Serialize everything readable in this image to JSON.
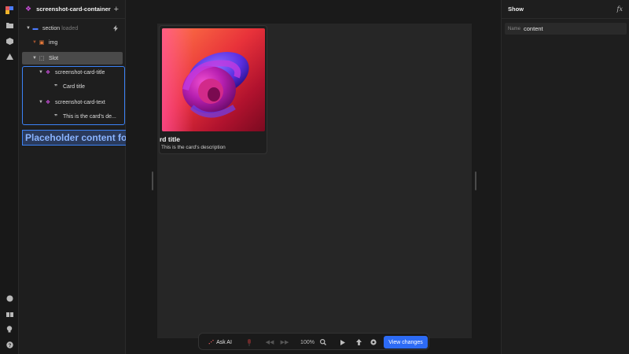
{
  "rail": {
    "icons_top": [
      "logo-icon",
      "folder-icon",
      "cube-icon",
      "warning-icon"
    ],
    "icons_bottom": [
      "palette-icon",
      "gift-icon",
      "lightbulb-icon",
      "help-icon"
    ]
  },
  "layers": {
    "title": "screenshot-card-container",
    "add_label": "+",
    "tree": {
      "section": {
        "label": "section",
        "badge": "loaded"
      },
      "img": {
        "label": "img"
      },
      "slot": {
        "label": "Slot"
      },
      "card_title_component": {
        "label": "screenshot-card-title"
      },
      "card_title_text": {
        "label": "Card title"
      },
      "card_text_component": {
        "label": "screenshot-card-text"
      },
      "card_text_text": {
        "label": "This is the card's de..."
      }
    },
    "tooltip": "Placeholder content for the slot"
  },
  "canvas": {
    "card": {
      "title": "rd title",
      "description": "This is the card's description"
    }
  },
  "toolbar": {
    "ask_ai": "Ask AI",
    "zoom": "100%",
    "view_changes": "View changes"
  },
  "properties": {
    "title": "Show",
    "fx_label": "fx",
    "field_label": "Name",
    "field_value": "content"
  },
  "colors": {
    "accent": "#3b82f6",
    "component": "#c84ed9",
    "button": "#2d6bf5"
  }
}
